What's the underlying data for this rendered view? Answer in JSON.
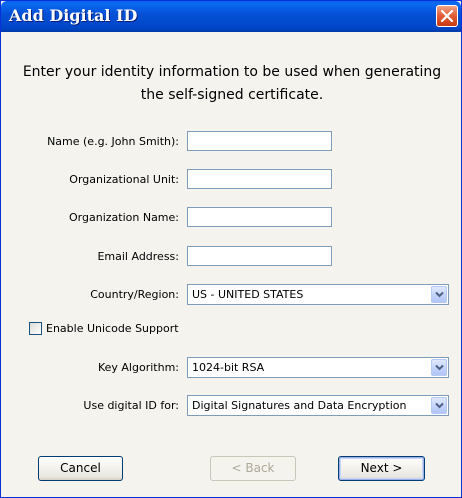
{
  "window": {
    "title": "Add Digital ID",
    "close_icon": "close-icon"
  },
  "intro": {
    "line1": "Enter your identity information to be used when generating",
    "line2": "the self-signed certificate."
  },
  "form": {
    "name_label": "Name (e.g. John Smith):",
    "name_value": "",
    "org_unit_label": "Organizational Unit:",
    "org_unit_value": "",
    "org_name_label": "Organization Name:",
    "org_name_value": "",
    "email_label": "Email Address:",
    "email_value": "",
    "country_label": "Country/Region:",
    "country_value": "US - UNITED STATES",
    "unicode_label": "Enable Unicode Support",
    "unicode_checked": false,
    "key_algorithm_label": "Key Algorithm:",
    "key_algorithm_value": "1024-bit RSA",
    "use_for_label": "Use digital ID for:",
    "use_for_value": "Digital Signatures and Data Encryption"
  },
  "buttons": {
    "cancel": "Cancel",
    "back": "< Back",
    "next": "Next >"
  },
  "colors": {
    "titlebar": "#0452d8",
    "dialog_bg": "#f4f3ee",
    "input_border": "#7f9db9",
    "close_button": "#e3603a"
  }
}
